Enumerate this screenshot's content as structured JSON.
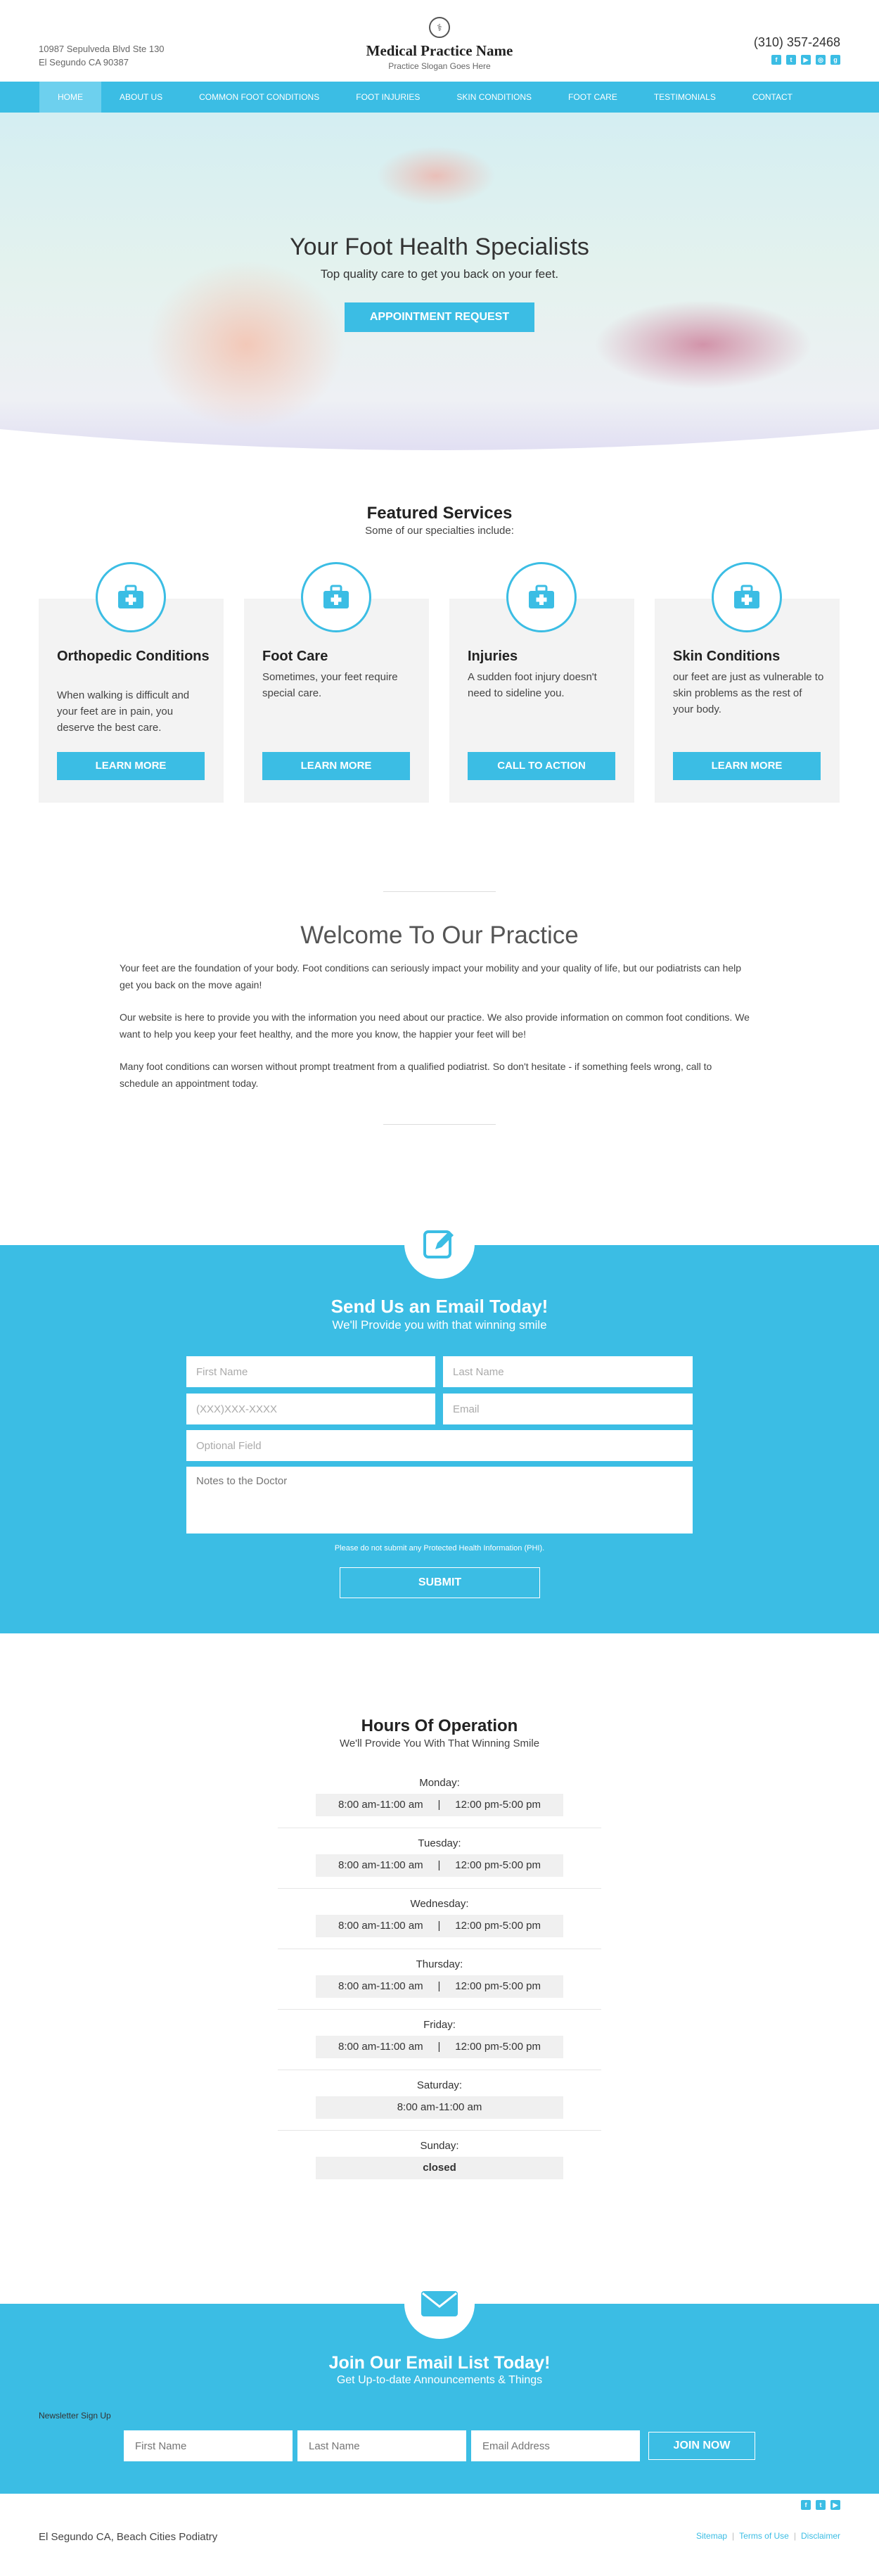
{
  "header": {
    "address_line1": "10987 Sepulveda Blvd Ste 130",
    "address_line2": "El Segundo CA 90387",
    "brand_name": "Medical Practice Name",
    "brand_slogan": "Practice Slogan Goes Here",
    "phone": "(310) 357-2468",
    "socials": [
      "facebook-icon",
      "twitter-icon",
      "youtube-icon",
      "instagram-icon",
      "google-plus-icon"
    ]
  },
  "nav": {
    "items": [
      {
        "label": "Home",
        "active": true
      },
      {
        "label": "About Us"
      },
      {
        "label": "Common Foot Conditions"
      },
      {
        "label": "Foot Injuries"
      },
      {
        "label": "Skin Conditions"
      },
      {
        "label": "Foot Care"
      },
      {
        "label": "Testimonials"
      },
      {
        "label": "Contact"
      }
    ]
  },
  "hero": {
    "title": "Your Foot Health Specialists",
    "subtitle": "Top quality care to get you back on your feet.",
    "button": "Appointment Request"
  },
  "services": {
    "title": "Featured Services",
    "subtitle": "Some of our specialties include:",
    "cards": [
      {
        "title": "Orthopedic Conditions",
        "text": "When walking is difficult and your feet are in pain, you deserve the best care.",
        "button": "Learn More",
        "icon": "medical-kit-icon"
      },
      {
        "title": "Foot Care",
        "text": "Sometimes, your feet require special care.",
        "button": "Learn More",
        "icon": "medical-kit-icon"
      },
      {
        "title": "Injuries",
        "text": "A sudden foot injury doesn't need to sideline you.",
        "button": "Call To Action",
        "icon": "medical-kit-icon"
      },
      {
        "title": "Skin Conditions",
        "text": "our feet are just as vulnerable to skin problems as the rest of your body.",
        "button": "Learn More",
        "icon": "medical-kit-icon"
      }
    ]
  },
  "welcome": {
    "title": "Welcome To Our Practice",
    "paragraphs": [
      "Your feet are the foundation of your body. Foot conditions can seriously impact your mobility and your quality of life, but our podiatrists can help get you back on the move again!",
      "Our website is here to provide you with the information you need about our practice. We also provide information on common foot conditions. We want to help you keep your feet healthy, and the more you know, the happier your feet will be!",
      "Many foot conditions can worsen without prompt treatment from a qualified podiatrist. So don't hesitate - if something feels wrong, call to schedule an appointment today."
    ]
  },
  "email_form": {
    "title": "Send Us an Email Today!",
    "subtitle": "We'll Provide you with that winning smile",
    "first_name_placeholder": "First Name",
    "last_name_placeholder": "Last Name",
    "phone_placeholder": "(XXX)XXX-XXXX",
    "email_placeholder": "Email",
    "optional_placeholder": "Optional Field",
    "notes_placeholder": "Notes to the Doctor",
    "disclaimer": "Please do not submit any Protected Health Information (PHI).",
    "submit": "Submit"
  },
  "hours": {
    "title": "Hours Of Operation",
    "subtitle": "We'll Provide You With That Winning Smile",
    "days": [
      {
        "day": "Monday:",
        "hours": "8:00 am-11:00 am     |     12:00 pm-5:00 pm"
      },
      {
        "day": "Tuesday:",
        "hours": "8:00 am-11:00 am     |     12:00 pm-5:00 pm"
      },
      {
        "day": "Wednesday:",
        "hours": "8:00 am-11:00 am     |     12:00 pm-5:00 pm"
      },
      {
        "day": "Thursday:",
        "hours": "8:00 am-11:00 am     |     12:00 pm-5:00 pm"
      },
      {
        "day": "Friday:",
        "hours": "8:00 am-11:00 am     |     12:00 pm-5:00 pm"
      },
      {
        "day": "Saturday:",
        "hours": "8:00 am-11:00 am"
      },
      {
        "day": "Sunday:",
        "hours": "closed"
      }
    ]
  },
  "newsletter": {
    "title": "Join Our Email List Today!",
    "subtitle": "Get Up-to-date Announcements & Things",
    "label": "Newsletter Sign Up",
    "first_name_placeholder": "First Name",
    "last_name_placeholder": "Last Name",
    "email_placeholder": "Email Address",
    "button": "Join Now"
  },
  "footer": {
    "name": "El Segundo CA, Beach Cities Podiatry",
    "links": [
      "Sitemap",
      "Terms of Use",
      "Disclaimer"
    ],
    "socials": [
      "facebook-icon",
      "twitter-icon",
      "youtube-icon"
    ]
  },
  "colors": {
    "accent": "#3bbde4",
    "nav_active": "#6dd0ee"
  }
}
